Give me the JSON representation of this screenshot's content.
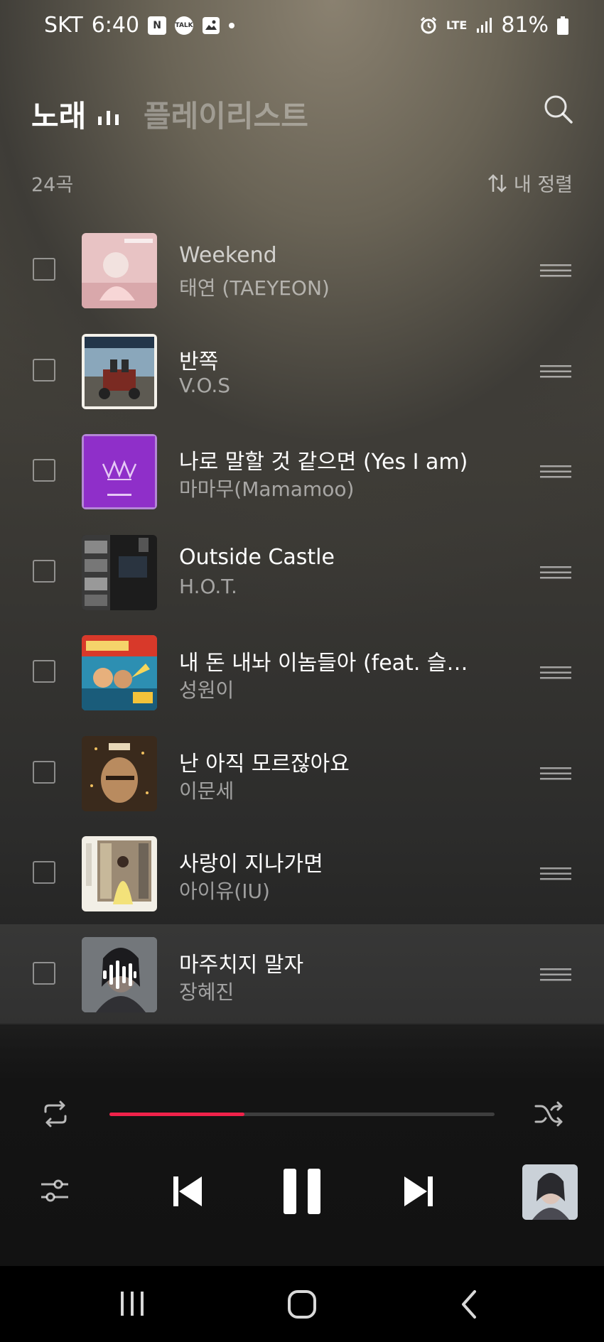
{
  "status_bar": {
    "carrier": "SKT",
    "time": "6:40",
    "notif_n": "N",
    "notif_talk": "TALK",
    "network": "LTE",
    "battery": "81%"
  },
  "header": {
    "tab_songs": "노래",
    "tab_playlist": "플레이리스트"
  },
  "list_info": {
    "count": "24곡",
    "sort_label": "내 정렬"
  },
  "songs": [
    {
      "title": "Weekend",
      "artist": "태연 (TAEYEON)"
    },
    {
      "title": "반쪽",
      "artist": "V.O.S"
    },
    {
      "title": "나로 말할 것 같으면 (Yes I am)",
      "artist": "마마무(Mamamoo)"
    },
    {
      "title": "Outside Castle",
      "artist": "H.O.T."
    },
    {
      "title": "내 돈 내놔 이놈들아 (feat. 슬…",
      "artist": "성원이"
    },
    {
      "title": "난 아직 모르잖아요",
      "artist": "이문세"
    },
    {
      "title": "사랑이 지나가면",
      "artist": "아이유(IU)"
    },
    {
      "title": "마주치지 말자",
      "artist": "장혜진",
      "playing": true
    }
  ],
  "player": {
    "progress": 0.35
  },
  "icons": [
    "eq-bars-icon",
    "search-icon",
    "sort-icon",
    "drag-handle-icon",
    "repeat-icon",
    "shuffle-icon",
    "equalizer-settings-icon",
    "prev-icon",
    "pause-icon",
    "next-icon",
    "recent-apps-icon",
    "home-icon",
    "back-icon"
  ],
  "colors": {
    "accent": "#f0224a"
  }
}
